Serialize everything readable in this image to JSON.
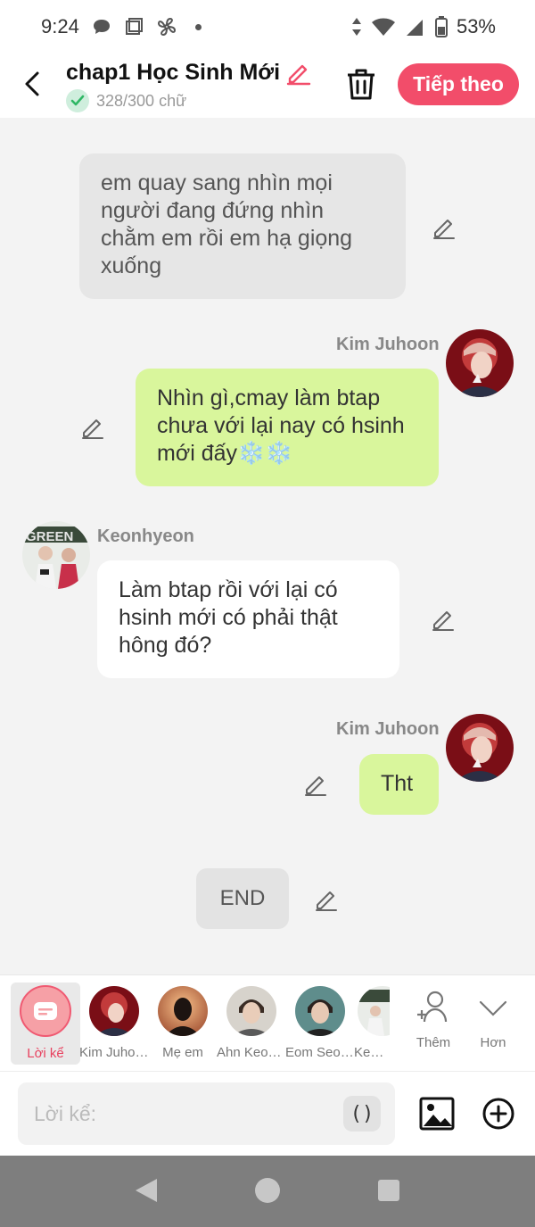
{
  "status_bar": {
    "time": "9:24",
    "battery": "53%",
    "icons": [
      "chat-bubble-icon",
      "square-icon",
      "fan-icon",
      "dot-icon",
      "data-arrows-icon",
      "wifi-icon",
      "signal-icon",
      "battery-icon"
    ]
  },
  "header": {
    "title": "chap1 Học Sinh Mới",
    "word_count": "328/300 chữ",
    "next_label": "Tiếp theo",
    "accent": "#f24d6a"
  },
  "messages": [
    {
      "type": "narration",
      "text": "em quay sang nhìn mọi người đang đứng nhìn chằm em rồi em hạ giọng xuống"
    },
    {
      "type": "right",
      "sender": "Kim Juhoon",
      "text": "Nhìn gì,cmay làm btap chưa với lại nay có hsinh mới đấy❄️❄️"
    },
    {
      "type": "left",
      "sender": "Keonhyeon",
      "text": "Làm btap rồi với lại có hsinh mới có phải thật hông đó?"
    },
    {
      "type": "right",
      "sender": "Kim Juhoon",
      "text": "Tht"
    },
    {
      "type": "end",
      "text": "END"
    }
  ],
  "characters": [
    {
      "name": "Lời kể",
      "active": true
    },
    {
      "name": "Kim Juhoon"
    },
    {
      "name": "Mẹ em"
    },
    {
      "name": "Ahn Keon..."
    },
    {
      "name": "Eom Seon..."
    },
    {
      "name": "Keonh"
    }
  ],
  "actions": {
    "add_label": "Thêm",
    "more_label": "Hơn"
  },
  "input": {
    "placeholder": "Lời kể:",
    "paren_label": "()"
  },
  "colors": {
    "green_bubble": "#d9f69c",
    "narration_bubble": "#e6e6e6",
    "background": "#f3f3f3"
  }
}
